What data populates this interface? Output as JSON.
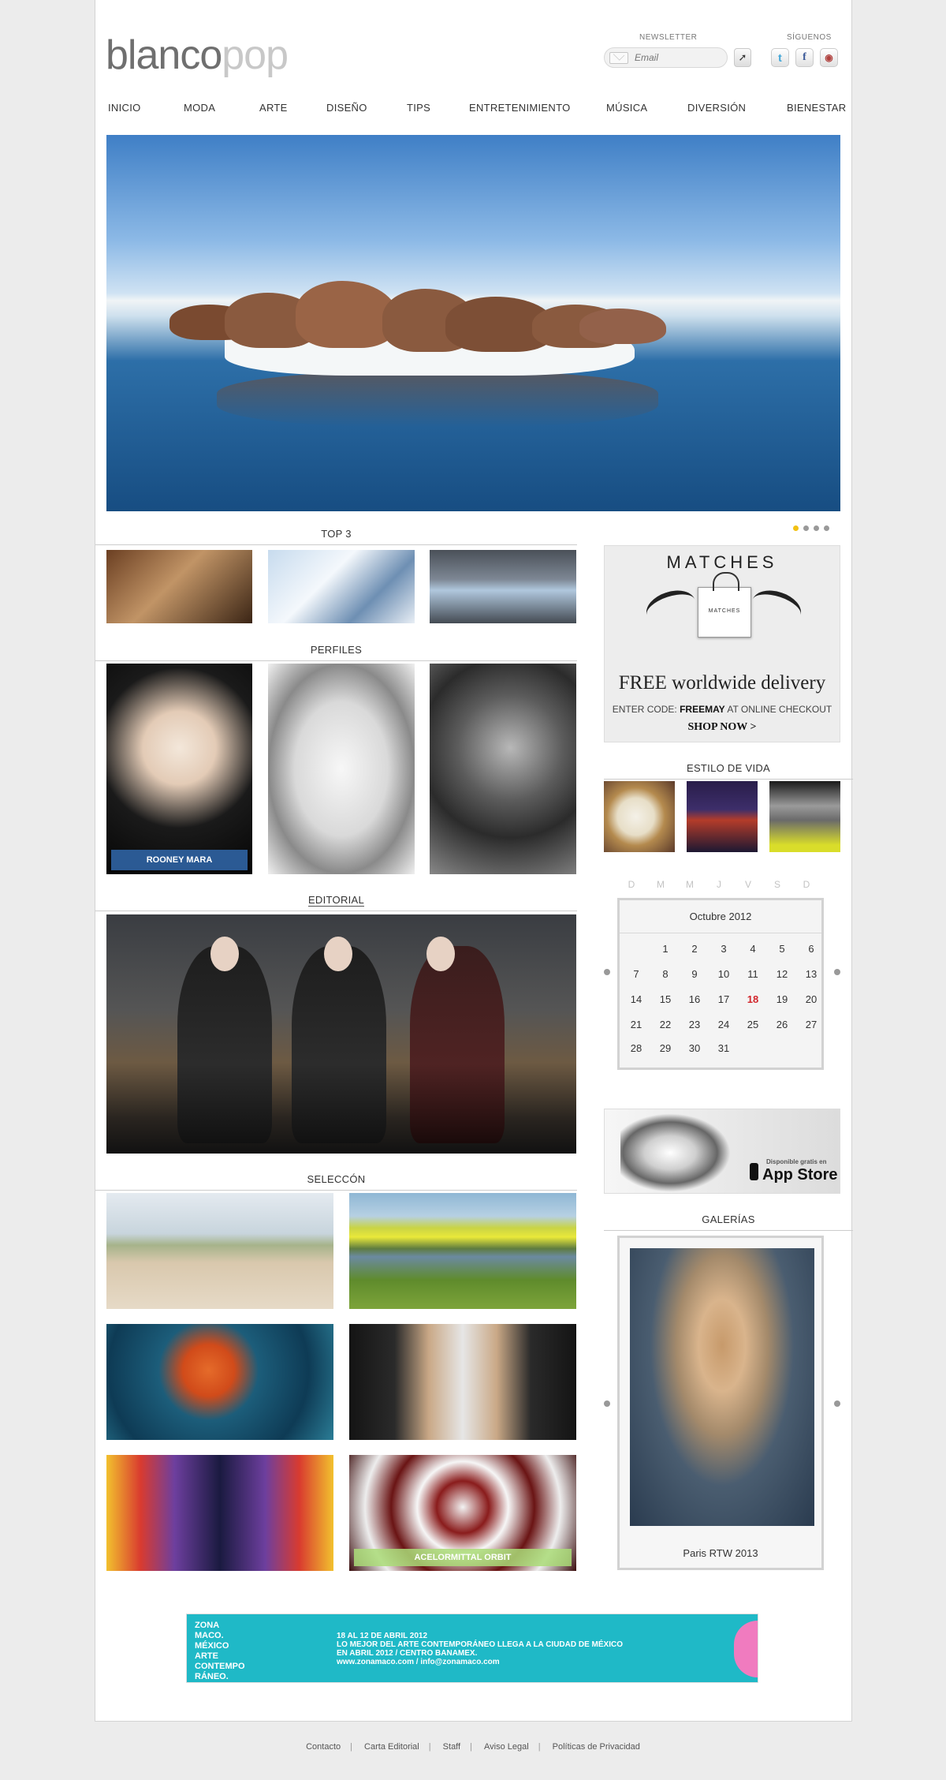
{
  "brand": {
    "logo_part1": "blanco",
    "logo_part2": "pop"
  },
  "newsletter": {
    "label": "NEWSLETTER",
    "placeholder": "Email"
  },
  "social": {
    "label": "SÍGUENOS",
    "twitter": "t",
    "facebook": "f",
    "instagram": "◉"
  },
  "nav": [
    "INICIO",
    "MODA",
    "ARTE",
    "DISEÑO",
    "TIPS",
    "ENTRETENIMIENTO",
    "MÚSICA",
    "DIVERSIÓN",
    "BIENESTAR"
  ],
  "slider": {
    "dot_count": 4,
    "active_dot": 1
  },
  "sections": {
    "top3": "TOP 3",
    "perfiles": "PERFILES",
    "editorial": "EDITORIAL",
    "seleccion": "SELECCÓN",
    "estilo": "ESTILO DE VIDA",
    "galerias": "GALERÍAS"
  },
  "perfiles": {
    "caption1": "ROONEY MARA"
  },
  "seleccion": {
    "caption6": "ACELORMITTAL ORBIT"
  },
  "matches_ad": {
    "brand": "MATCHES",
    "bag_label": "MATCHES",
    "free_text": "FREE worldwide delivery",
    "code_prefix": "ENTER CODE:",
    "code": "FREEMAY",
    "code_suffix": "AT ONLINE CHECKOUT",
    "cta": "SHOP NOW >"
  },
  "calendar": {
    "weekdays": [
      "D",
      "M",
      "M",
      "J",
      "V",
      "S",
      "D"
    ],
    "month": "Octubre 2012",
    "weeks": [
      [
        "",
        "1",
        "2",
        "3",
        "4",
        "5",
        "6"
      ],
      [
        "7",
        "8",
        "9",
        "10",
        "11",
        "12",
        "13"
      ],
      [
        "14",
        "15",
        "16",
        "17",
        "18",
        "19",
        "20"
      ],
      [
        "21",
        "22",
        "23",
        "24",
        "25",
        "26",
        "27"
      ],
      [
        "28",
        "29",
        "30",
        "31",
        "",
        "",
        ""
      ]
    ],
    "today": "18"
  },
  "appstore_ad": {
    "available": "Disponible gratis en",
    "store": "App Store"
  },
  "gallery": {
    "caption": "Paris RTW 2013"
  },
  "zona_ad": {
    "logo_lines": [
      "ZONA",
      "MACO.",
      "MÉXICO",
      "ARTE",
      "CONTEMPO",
      "RÁNEO."
    ],
    "text_lines": [
      "18 AL 12 DE ABRIL 2012",
      "LO MEJOR DEL ARTE CONTEMPORÁNEO LLEGA A LA CIUDAD DE MÉXICO",
      "EN ABRIL 2012 / CENTRO BANAMEX.",
      "www.zonamaco.com / info@zonamaco.com"
    ]
  },
  "footer": [
    "Contacto",
    "Carta Editorial",
    "Staff",
    "Aviso Legal",
    "Políticas de Privacidad"
  ],
  "footer_separator": "|"
}
